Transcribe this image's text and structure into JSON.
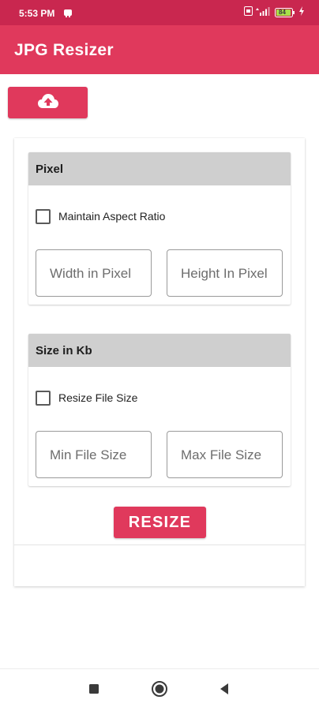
{
  "status_bar": {
    "time": "5:53 PM",
    "battery": "84"
  },
  "app_bar": {
    "title": "JPG Resizer"
  },
  "upload": {
    "icon": "cloud-upload-icon"
  },
  "pixel_section": {
    "title": "Pixel",
    "checkbox_label": "Maintain Aspect Ratio",
    "checkbox_checked": false,
    "width_placeholder": "Width in Pixel",
    "height_placeholder": "Height In Pixel"
  },
  "size_section": {
    "title": "Size in Kb",
    "checkbox_label": "Resize File Size",
    "checkbox_checked": false,
    "min_placeholder": "Min File Size",
    "max_placeholder": "Max File Size"
  },
  "actions": {
    "resize_label": "RESIZE"
  },
  "nav_bar": {
    "recents_icon": "square-icon",
    "home_icon": "circle-icon",
    "back_icon": "triangle-back-icon"
  },
  "colors": {
    "status_bar": "#c9274f",
    "primary": "#e0395c",
    "section_header": "#cfcfcf"
  }
}
